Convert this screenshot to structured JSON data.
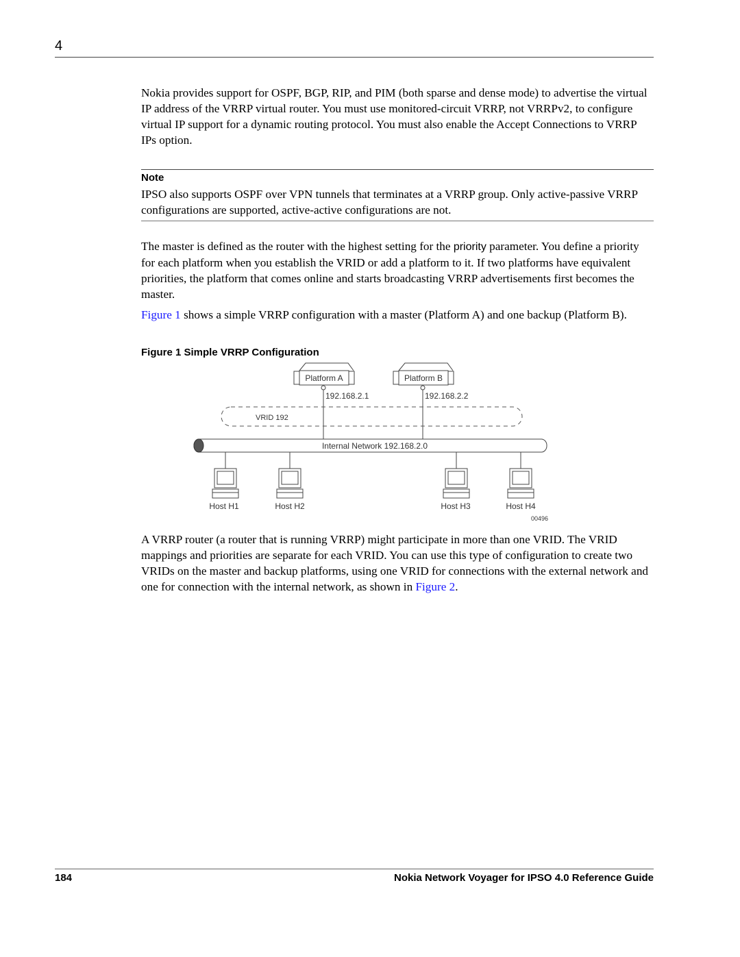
{
  "header": {
    "chapter_number": "4"
  },
  "paragraphs": {
    "p1": "Nokia provides support for OSPF, BGP, RIP, and PIM (both sparse and dense mode) to advertise the virtual IP address of the VRRP virtual router. You must use monitored-circuit VRRP, not VRRPv2, to configure virtual IP support for a dynamic routing protocol. You must also enable the Accept Connections to VRRP IPs option.",
    "p2_before": "The master is defined as the router with the highest setting for the ",
    "p2_term": "priority",
    "p2_after": " parameter. You define a priority for each platform when you establish the VRID or add a platform to it. If two platforms have equivalent priorities, the platform that comes online and starts broadcasting VRRP advertisements first becomes the master.",
    "p3_link": "Figure 1",
    "p3_after": " shows a simple VRRP configuration with a master (Platform A) and one backup (Platform B).",
    "p4_before": "A VRRP router (a router that is running VRRP) might participate in more than one VRID. The VRID mappings and priorities are separate for each VRID. You can use this type of configuration to create two VRIDs on the master and backup platforms, using one VRID for connections with the external network and one for connection with the internal network, as shown in ",
    "p4_link": "Figure 2",
    "p4_after": "."
  },
  "note": {
    "title": "Note",
    "body": "IPSO also supports OSPF over VPN tunnels that terminates at a VRRP group. Only active-passive VRRP configurations are supported, active-active configurations are not."
  },
  "figure": {
    "caption": "Figure 1  Simple VRRP Configuration",
    "platforms": [
      {
        "label": "Platform A",
        "ip": "192.168.2.1"
      },
      {
        "label": "Platform B",
        "ip": "192.168.2.2"
      }
    ],
    "vrid_label": "VRID 192",
    "network_label": "Internal Network 192.168.2.0",
    "hosts": [
      "Host H1",
      "Host H2",
      "Host H3",
      "Host H4"
    ],
    "figure_id": "00496"
  },
  "footer": {
    "page_number": "184",
    "doc_title": "Nokia Network Voyager for IPSO 4.0 Reference Guide"
  },
  "colors": {
    "link": "#1a1aff",
    "network_cap": "#555555"
  }
}
